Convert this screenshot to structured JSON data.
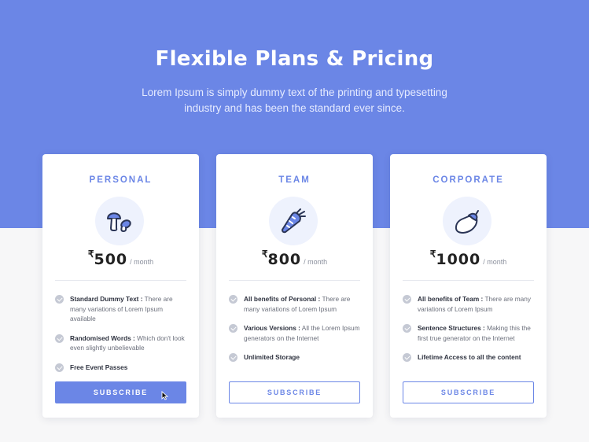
{
  "header": {
    "title": "Flexible Plans & Pricing",
    "subtitle": "Lorem Ipsum is simply dummy text of the printing and typesetting industry and has been the standard ever since."
  },
  "colors": {
    "accent": "#6b86e6",
    "background": "#f7f7f8",
    "card": "#ffffff"
  },
  "plans": [
    {
      "name": "PERSONAL",
      "icon": "mushroom-icon",
      "currency": "₹",
      "price": "500",
      "period": "/ month",
      "features": [
        {
          "title": "Standard Dummy Text :",
          "text": "There are many variations of Lorem Ipsum available"
        },
        {
          "title": "Randomised Words :",
          "text": "Which don't look even slightly unbelievable"
        },
        {
          "title": "Free Event Passes",
          "text": ""
        }
      ],
      "button": "SUBSCRIBE",
      "button_style": "filled"
    },
    {
      "name": "TEAM",
      "icon": "carrot-icon",
      "currency": "₹",
      "price": "800",
      "period": "/ month",
      "features": [
        {
          "title": "All benefits of Personal :",
          "text": "There are many variations of Lorem Ipsum"
        },
        {
          "title": "Various Versions :",
          "text": "All the Lorem Ipsum generators on the Internet"
        },
        {
          "title": "Unlimited Storage",
          "text": ""
        }
      ],
      "button": "SUBSCRIBE",
      "button_style": "outline"
    },
    {
      "name": "CORPORATE",
      "icon": "eggplant-icon",
      "currency": "₹",
      "price": "1000",
      "period": "/ month",
      "features": [
        {
          "title": "All benefits of Team :",
          "text": "There are many variations of Lorem Ipsum"
        },
        {
          "title": "Sentence Structures :",
          "text": "Making this the first true generator on the Internet"
        },
        {
          "title": "Lifetime Access to all the content",
          "text": ""
        }
      ],
      "button": "SUBSCRIBE",
      "button_style": "outline"
    }
  ]
}
